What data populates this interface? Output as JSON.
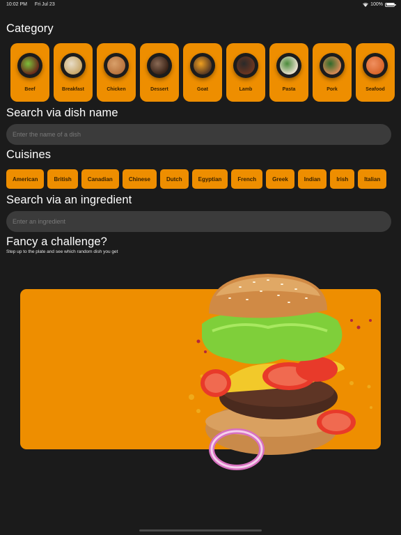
{
  "status_bar": {
    "time": "10:02 PM",
    "date": "Fri Jul 23",
    "battery": "100%",
    "battery_level": 1.0,
    "icons": [
      "wifi-icon",
      "battery-icon"
    ]
  },
  "category": {
    "title": "Category",
    "items": [
      {
        "label": "Beef",
        "colors": [
          "#6b2a1a",
          "#7bbf3a"
        ]
      },
      {
        "label": "Breakfast",
        "colors": [
          "#c9a86a",
          "#e8ddc8"
        ]
      },
      {
        "label": "Chicken",
        "colors": [
          "#b8733d",
          "#d9a06a"
        ]
      },
      {
        "label": "Dessert",
        "colors": [
          "#3b2418",
          "#8a6a55"
        ]
      },
      {
        "label": "Goat",
        "colors": [
          "#5a3a22",
          "#f0a020"
        ]
      },
      {
        "label": "Lamb",
        "colors": [
          "#6b3520",
          "#2a2a2a"
        ]
      },
      {
        "label": "Pasta",
        "colors": [
          "#e8e0cc",
          "#4a8a3a"
        ]
      },
      {
        "label": "Pork",
        "colors": [
          "#d88a55",
          "#2f6a2a"
        ]
      },
      {
        "label": "Seafood",
        "colors": [
          "#d8652a",
          "#f09060"
        ]
      }
    ]
  },
  "dish_search": {
    "title": "Search via dish name",
    "placeholder": "Enter the name of a dish",
    "value": ""
  },
  "cuisines": {
    "title": "Cuisines",
    "items": [
      "American",
      "British",
      "Canadian",
      "Chinese",
      "Dutch",
      "Egyptian",
      "French",
      "Greek",
      "Indian",
      "Irish",
      "Italian"
    ]
  },
  "ingredient_search": {
    "title": "Search via an ingredient",
    "placeholder": "Enter an ingredient",
    "value": ""
  },
  "challenge": {
    "title": "Fancy a challenge?",
    "subtitle": "Step up to the plate and see which random dish you get",
    "image": "burger-illustration"
  },
  "colors": {
    "background": "#1b1b1b",
    "accent": "#ee8e00",
    "input_bg": "#3b3b3b",
    "chip_text": "#3a2200"
  }
}
